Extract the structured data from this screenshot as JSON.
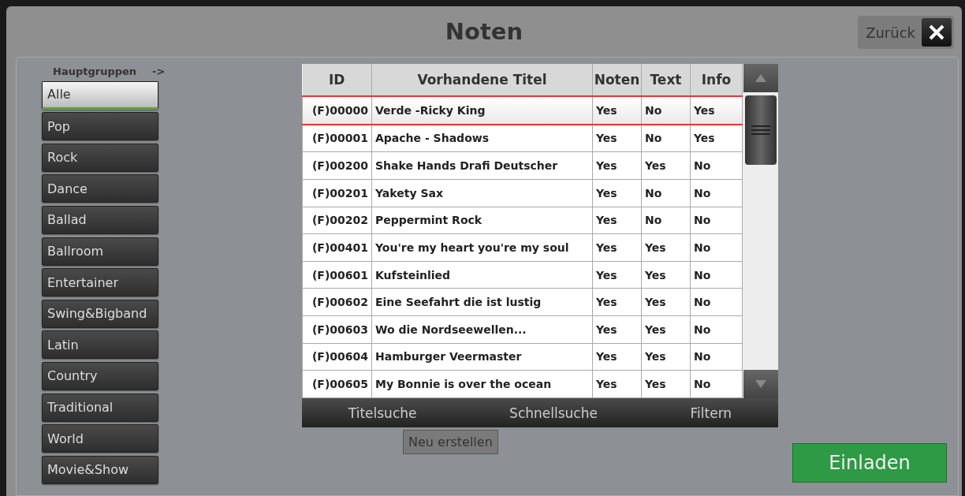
{
  "window": {
    "title": "Noten"
  },
  "back_button": {
    "label": "Zurück"
  },
  "groups": {
    "label": "Hauptgruppen",
    "arrow": "->",
    "items": [
      {
        "label": "Alle",
        "selected": true
      },
      {
        "label": "Pop",
        "selected": false
      },
      {
        "label": "Rock",
        "selected": false
      },
      {
        "label": "Dance",
        "selected": false
      },
      {
        "label": "Ballad",
        "selected": false
      },
      {
        "label": "Ballroom",
        "selected": false
      },
      {
        "label": "Entertainer",
        "selected": false
      },
      {
        "label": "Swing&Bigband",
        "selected": false
      },
      {
        "label": "Latin",
        "selected": false
      },
      {
        "label": "Country",
        "selected": false
      },
      {
        "label": "Traditional",
        "selected": false
      },
      {
        "label": "World",
        "selected": false
      },
      {
        "label": "Movie&Show",
        "selected": false
      }
    ]
  },
  "table": {
    "columns": [
      "ID",
      "Vorhandene Titel",
      "Noten",
      "Text",
      "Info"
    ],
    "rows": [
      {
        "cells": [
          "(F)00000",
          "Verde -Ricky King",
          "Yes",
          "No",
          "Yes"
        ],
        "selected": true
      },
      {
        "cells": [
          "(F)00001",
          "Apache - Shadows",
          "Yes",
          "No",
          "Yes"
        ],
        "selected": false
      },
      {
        "cells": [
          "(F)00200",
          "Shake Hands Drafi Deutscher",
          "Yes",
          "Yes",
          "No"
        ],
        "selected": false
      },
      {
        "cells": [
          "(F)00201",
          "Yakety Sax",
          "Yes",
          "No",
          "No"
        ],
        "selected": false
      },
      {
        "cells": [
          "(F)00202",
          "Peppermint Rock",
          "Yes",
          "No",
          "No"
        ],
        "selected": false
      },
      {
        "cells": [
          "(F)00401",
          "You're my heart you're my soul",
          "Yes",
          "Yes",
          "No"
        ],
        "selected": false
      },
      {
        "cells": [
          "(F)00601",
          "Kufsteinlied",
          "Yes",
          "Yes",
          "No"
        ],
        "selected": false
      },
      {
        "cells": [
          "(F)00602",
          "Eine Seefahrt die ist lustig",
          "Yes",
          "Yes",
          "No"
        ],
        "selected": false
      },
      {
        "cells": [
          "(F)00603",
          "Wo die Nordseewellen...",
          "Yes",
          "Yes",
          "No"
        ],
        "selected": false
      },
      {
        "cells": [
          "(F)00604",
          "Hamburger Veermaster",
          "Yes",
          "Yes",
          "No"
        ],
        "selected": false
      },
      {
        "cells": [
          "(F)00605",
          "My Bonnie is over the ocean",
          "Yes",
          "Yes",
          "No"
        ],
        "selected": false
      }
    ]
  },
  "toolbar": [
    "Titelsuche",
    "Schnellsuche",
    "Filtern"
  ],
  "new_button": {
    "label": "Neu erstellen"
  },
  "load_button": {
    "label": "Einladen"
  }
}
